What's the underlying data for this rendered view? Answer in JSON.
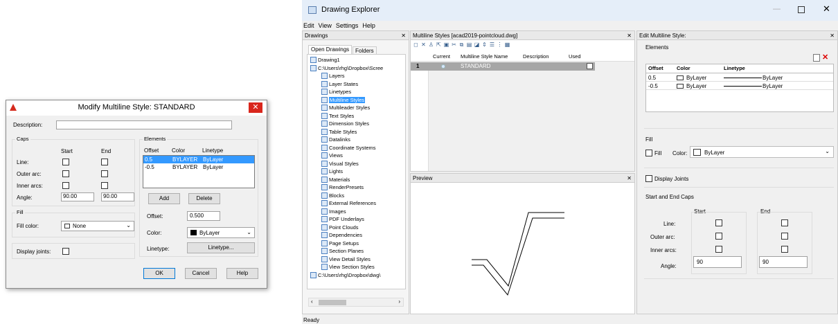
{
  "dialog": {
    "title": "Modify Multiline Style: STANDARD",
    "description_label": "Description:",
    "description_value": "",
    "caps": {
      "label": "Caps",
      "start": "Start",
      "end": "End",
      "line": "Line:",
      "outer": "Outer arc:",
      "inner": "Inner arcs:",
      "angle": "Angle:",
      "angle_start": "90.00",
      "angle_end": "90.00"
    },
    "fill": {
      "label": "Fill",
      "color_label": "Fill color:",
      "color_value": "None"
    },
    "display_joints": "Display joints:",
    "elements": {
      "label": "Elements",
      "cols": [
        "Offset",
        "Color",
        "Linetype"
      ],
      "rows": [
        [
          "0.5",
          "BYLAYER",
          "ByLayer"
        ],
        [
          "-0.5",
          "BYLAYER",
          "ByLayer"
        ]
      ],
      "add": "Add",
      "delete": "Delete",
      "offset_label": "Offset:",
      "offset_value": "0.500",
      "color_label": "Color:",
      "color_value": "ByLayer",
      "linetype_label": "Linetype:",
      "linetype_button": "Linetype..."
    },
    "ok": "OK",
    "cancel": "Cancel",
    "help": "Help"
  },
  "explorer": {
    "title": "Drawing Explorer",
    "menu": [
      "Edit",
      "View",
      "Settings",
      "Help"
    ],
    "drawings_pane": {
      "title": "Drawings",
      "tabs": [
        "Open Drawings",
        "Folders"
      ],
      "tree": [
        "Drawing1",
        "C:\\Users\\rhg\\Dropbox\\Scree",
        "Layers",
        "Layer States",
        "Linetypes",
        "Multiline Styles",
        "Multileader Styles",
        "Text Styles",
        "Dimension Styles",
        "Table Styles",
        "Datalinks",
        "Coordinate Systems",
        "Views",
        "Visual Styles",
        "Lights",
        "Materials",
        "RenderPresets",
        "Blocks",
        "External References",
        "Images",
        "PDF Underlays",
        "Point Clouds",
        "Dependencies",
        "Page Setups",
        "Section Planes",
        "View Detail Styles",
        "View Section Styles",
        "C:\\Users\\rhg\\Dropbox\\dwg\\"
      ]
    },
    "list_pane": {
      "title": "Multiline Styles [acad2019-pointcloud.dwg]",
      "cols": [
        "Current",
        "Multiline Style Name",
        "Description",
        "Used"
      ],
      "row": {
        "num": "1",
        "name": "STANDARD"
      }
    },
    "preview": {
      "title": "Preview"
    },
    "edit_pane": {
      "title": "Edit Multiline Style:",
      "elements": "Elements",
      "cols": [
        "Offset",
        "Color",
        "Linetype"
      ],
      "rows": [
        [
          "0.5",
          "ByLayer",
          "ByLayer"
        ],
        [
          "-0.5",
          "ByLayer",
          "ByLayer"
        ]
      ],
      "fill": "Fill",
      "fill_cb": "Fill",
      "color_label": "Color:",
      "color_value": "ByLayer",
      "display_joints": "Display Joints",
      "caps": "Start and End Caps",
      "start": "Start",
      "end": "End",
      "line": "Line:",
      "outer": "Outer arc:",
      "inner": "Inner arcs:",
      "angle": "Angle:",
      "angle_start": "90",
      "angle_end": "90"
    },
    "status": "Ready"
  },
  "colors": {
    "selection": "#3399ff",
    "titlebar": "#e5eef9"
  }
}
